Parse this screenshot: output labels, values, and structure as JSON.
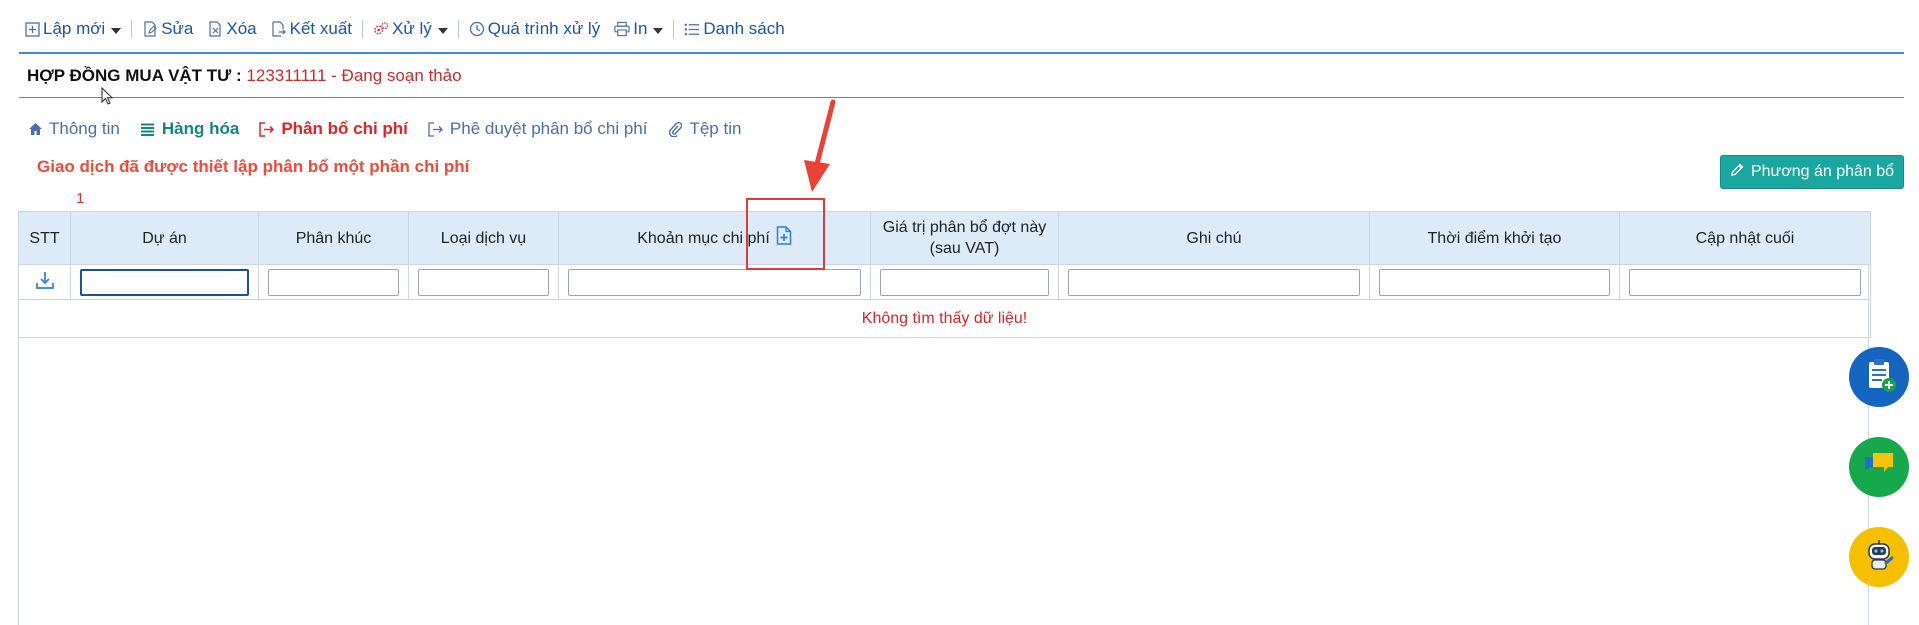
{
  "toolbar": {
    "new_label": "Lập mới",
    "edit_label": "Sửa",
    "delete_label": "Xóa",
    "export_label": "Kết xuất",
    "process_label": "Xử lý",
    "history_label": "Quá trình xử lý",
    "print_label": "In",
    "list_label": "Danh sách"
  },
  "document": {
    "title": "HỢP ĐỒNG MUA VẬT TƯ :",
    "code_status": "123311111 - Đang soạn thảo"
  },
  "tabs": [
    {
      "label": "Thông tin",
      "icon": "home-icon"
    },
    {
      "label": "Hàng hóa",
      "icon": "list-lines-icon"
    },
    {
      "label": "Phân bổ chi phí",
      "icon": "share-arrow-icon"
    },
    {
      "label": "Phê duyệt phân bổ chi phí",
      "icon": "share-arrow-icon"
    },
    {
      "label": "Tệp tin",
      "icon": "paperclip-icon"
    }
  ],
  "notice": "Giao dịch đã được thiết lập phân bổ một phần chi phí",
  "row_count": "1",
  "plan_button_label": "Phương án phân bổ",
  "grid": {
    "columns": [
      "STT",
      "Dự án",
      "Phân khúc",
      "Loại dịch vụ",
      "Khoản mục chi phí",
      "Giá trị phân bổ đợt này (sau VAT)",
      "Ghi chú",
      "Thời điểm khởi tạo",
      "Cập nhật cuối"
    ],
    "empty_message": "Không tìm thấy dữ liệu!"
  },
  "colors": {
    "accent_blue": "#1a55a8",
    "rule_blue": "#3a8fd8",
    "alert_red": "#e02424",
    "teal": "#1aa7a0",
    "header_bg": "#ddebf9"
  }
}
